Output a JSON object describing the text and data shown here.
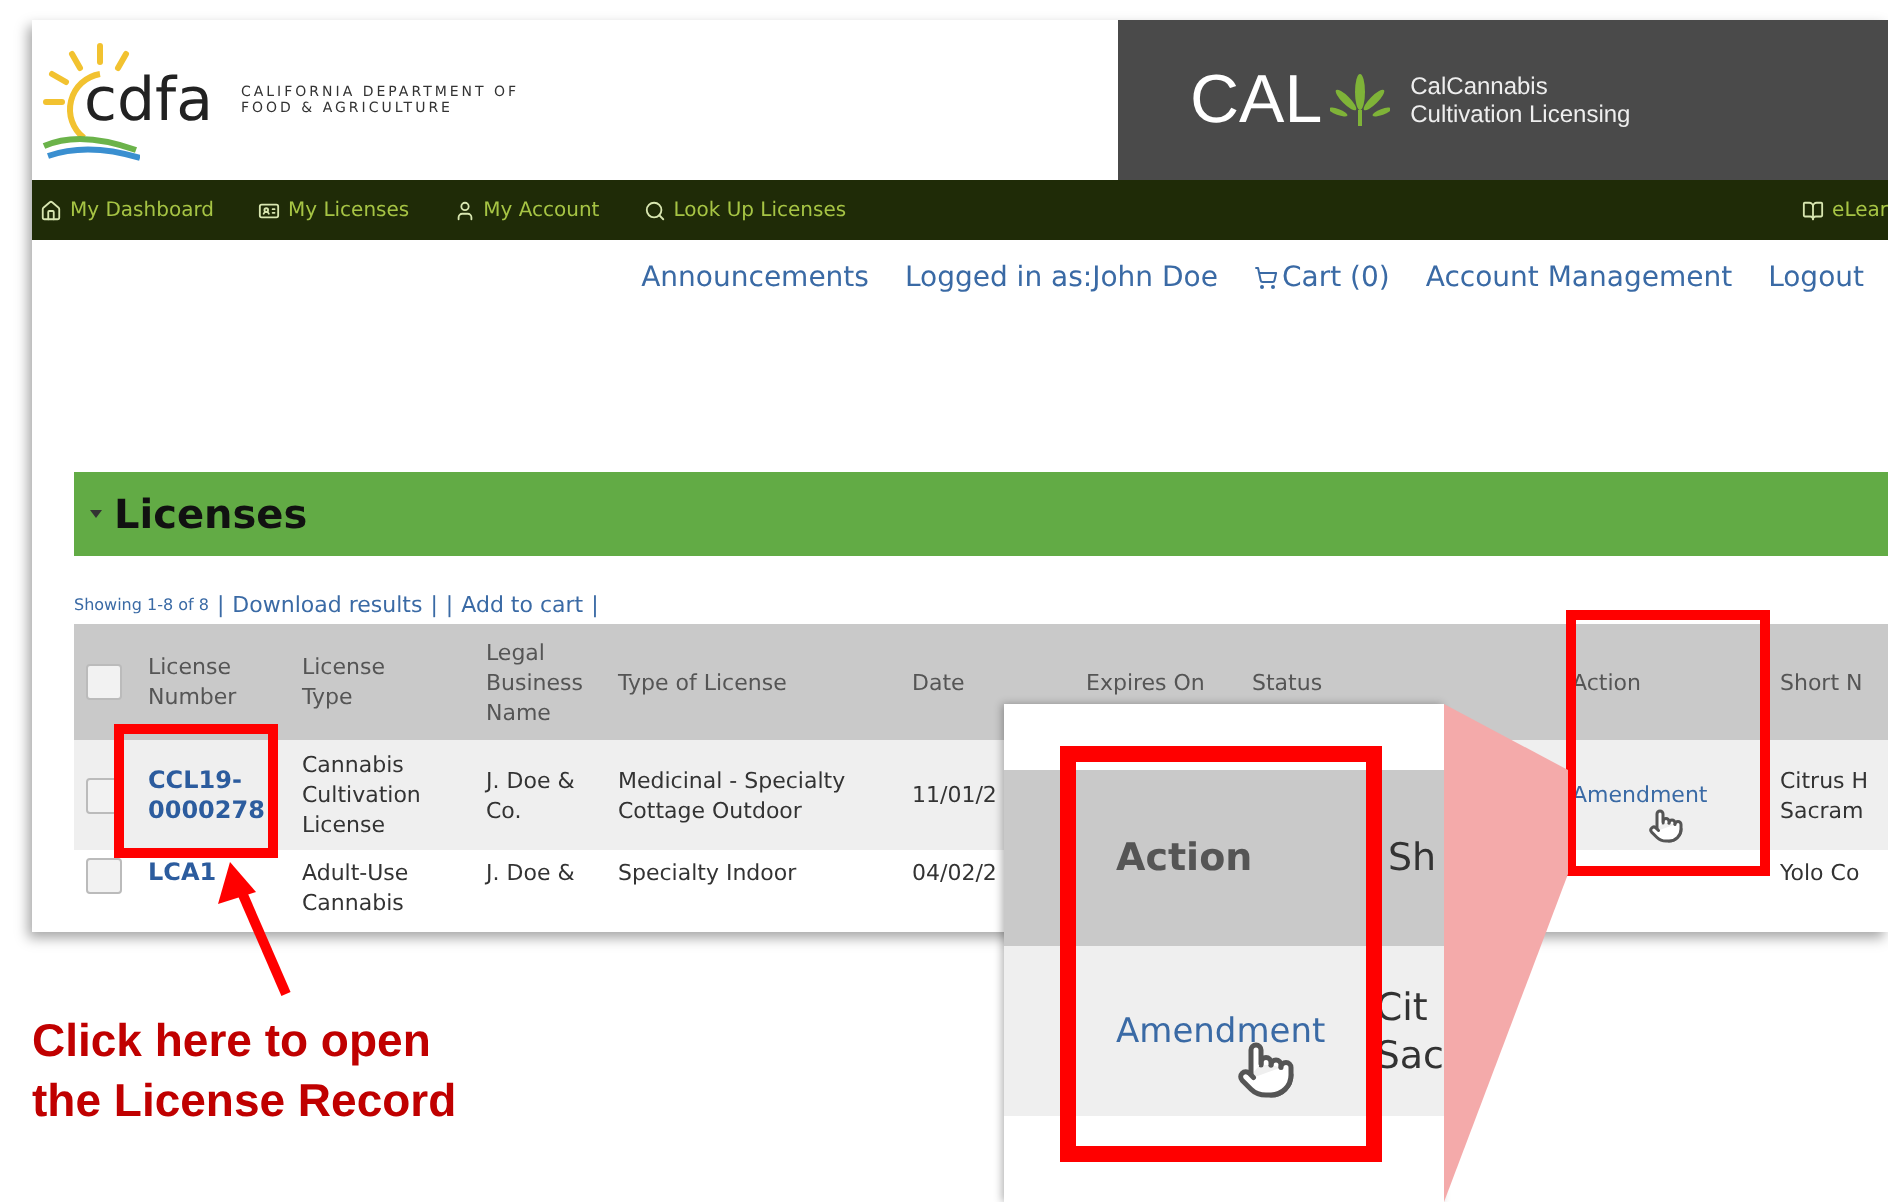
{
  "header": {
    "logo_text": "cdfa",
    "agency_name": [
      "CALIFORNIA DEPARTMENT OF",
      "FOOD & AGRICULTURE"
    ],
    "brand": "CAL",
    "brand_subtitle": [
      "CalCannabis",
      "Cultivation Licensing"
    ]
  },
  "nav": [
    {
      "label": "My Dashboard"
    },
    {
      "label": "My Licenses"
    },
    {
      "label": "My Account"
    },
    {
      "label": "Look Up Licenses"
    },
    {
      "label": "eLear"
    }
  ],
  "top_links": [
    {
      "label": "Announcements"
    },
    {
      "label": "Logged in as:John Doe"
    },
    {
      "label": "Cart (0)"
    },
    {
      "label": "Account Management"
    },
    {
      "label": "Logout"
    }
  ],
  "section": {
    "title": "Licenses"
  },
  "results_bar": [
    {
      "kind": "summary",
      "text": "Showing 1-8 of 8"
    },
    {
      "kind": "separator",
      "text": "|"
    },
    {
      "kind": "link",
      "text": "Download results"
    },
    {
      "kind": "separator",
      "text": "|"
    },
    {
      "kind": "separator",
      "text": "|"
    },
    {
      "kind": "link",
      "text": "Add to cart"
    },
    {
      "kind": "separator",
      "text": "|"
    }
  ],
  "table": {
    "select_all": {
      "checked": false
    },
    "columns": [
      {
        "label": "License Number",
        "kind": "link"
      },
      {
        "label": "License Type",
        "kind": "text"
      },
      {
        "label": "Legal Business Name",
        "kind": "text"
      },
      {
        "label": "Type of License",
        "kind": "text"
      },
      {
        "label": "Date",
        "kind": "text"
      },
      {
        "label": "Expires On"
      },
      {
        "label": "Status"
      },
      {
        "label": "Action",
        "kind": "action"
      },
      {
        "label": "Short N",
        "kind": "text"
      }
    ],
    "rows": [
      {
        "checked": false,
        "cells": [
          "CCL19-0000278",
          "Cannabis Cultivation License",
          "J. Doe & Co.",
          "Medicinal - Specialty Cottage Outdoor",
          "11/01/2",
          null,
          null,
          "Amendment",
          "Citrus H Sacram"
        ]
      },
      {
        "checked": false,
        "cells": [
          "LCA1",
          "Adult-Use Cannabis",
          "J. Doe &",
          "Specialty Indoor",
          "04/02/2",
          null,
          null,
          null,
          "Yolo Co"
        ]
      }
    ]
  },
  "callout": {
    "header": "Action",
    "link": "Amendment",
    "next_header": "Sh",
    "next_cell": [
      "Cit",
      "Sac"
    ]
  },
  "annotation": {
    "text": "Click here to open the License Record"
  }
}
